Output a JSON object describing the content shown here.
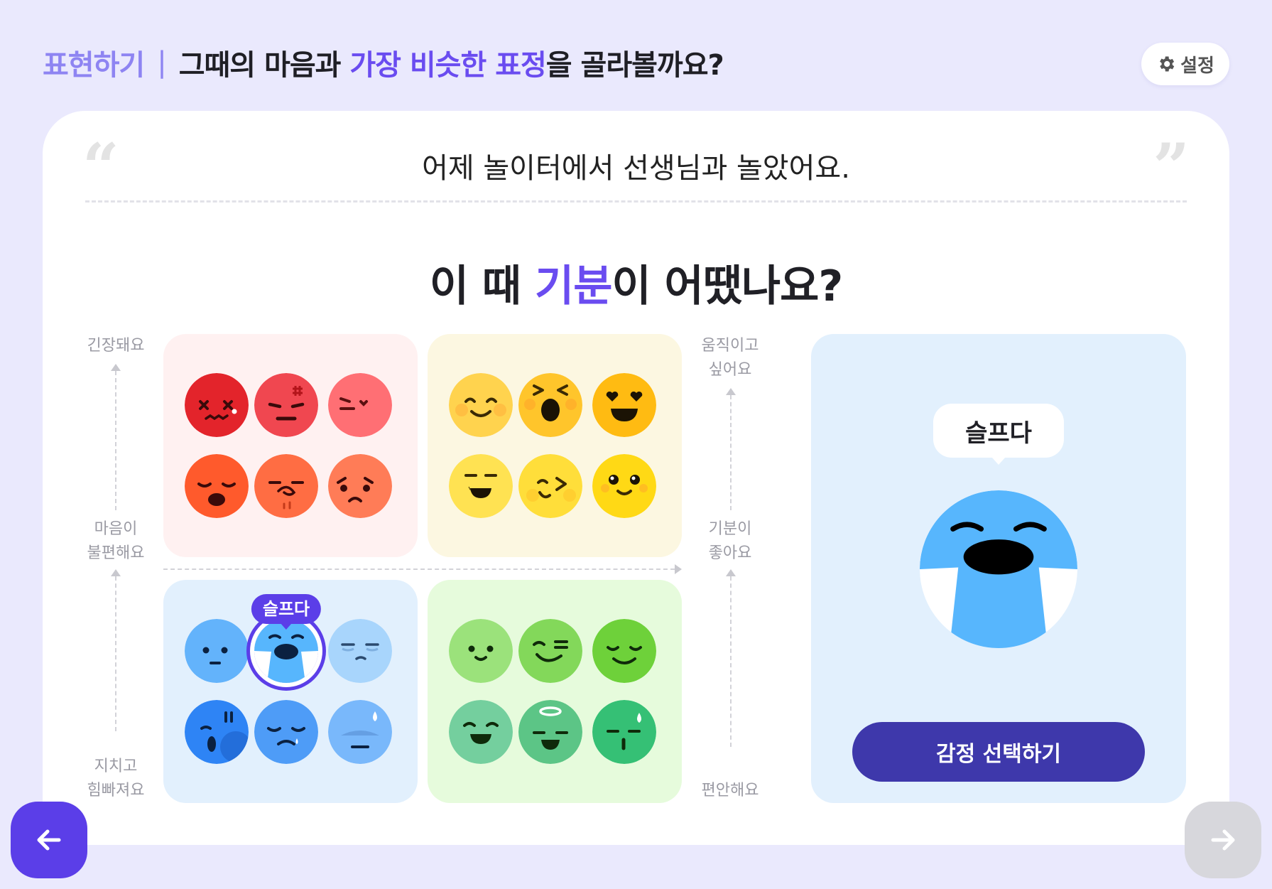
{
  "header": {
    "step": "표현하기",
    "separator": "|",
    "prompt_a": "그때의 마음과 ",
    "prompt_highlight": "가장 비슷한 표정",
    "prompt_b": "을 골라볼까요?"
  },
  "settings": {
    "label": "설정",
    "icon": "gear-icon"
  },
  "diary": {
    "sentence": "어제 놀이터에서 선생님과 놀았어요."
  },
  "question": {
    "part_a": "이 때 ",
    "highlight": "기분",
    "part_b": "이 어땠나요?"
  },
  "axes": {
    "left_top": "긴장돼요",
    "left_mid_1": "마음이",
    "left_mid_2": "불편해요",
    "left_bottom_1": "지치고",
    "left_bottom_2": "힘빠져요",
    "right_top_1": "움직이고",
    "right_top_2": "싶어요",
    "right_mid_1": "기분이",
    "right_mid_2": "좋아요",
    "right_bottom": "편안해요"
  },
  "emotion_grid": {
    "selected": "슬프다",
    "quadrants": [
      {
        "name": "red",
        "colors": [
          "#e3242b",
          "#f04750",
          "#ff6f74",
          "#ff5a2c",
          "#ff6d43",
          "#ff7c57"
        ]
      },
      {
        "name": "yellow",
        "colors": [
          "#ffd34e",
          "#ffc52b",
          "#ffbb12",
          "#ffe252",
          "#ffde3a",
          "#ffd915"
        ]
      },
      {
        "name": "blue",
        "colors": [
          "#63b3fb",
          "#57b6fd",
          "#a8d5fc",
          "#2e84f5",
          "#4e9cf7",
          "#79b8fb"
        ]
      },
      {
        "name": "green",
        "colors": [
          "#9be27b",
          "#83d85a",
          "#6ed13a",
          "#74cf9e",
          "#5cc586",
          "#35c075"
        ]
      }
    ]
  },
  "preview": {
    "emotion_label": "슬프다",
    "face_color": "#57b6fd",
    "button_label": "감정 선택하기"
  },
  "navigation": {
    "prev_icon": "arrow-left-icon",
    "next_icon": "arrow-right-icon",
    "prev_color": "#5b3ee8",
    "next_color": "#d7d7dc"
  }
}
